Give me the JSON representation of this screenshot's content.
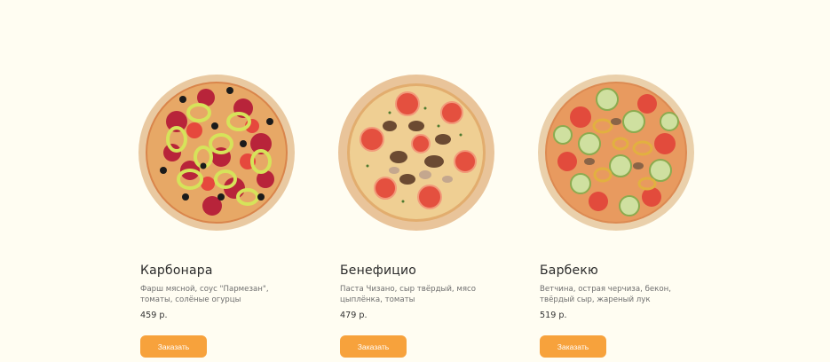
{
  "colors": {
    "background": "#fffdf2",
    "accent": "#f7a23c",
    "title": "#2b2b2b",
    "description": "#6f6f6f"
  },
  "products": [
    {
      "name": "Карбонара",
      "description": "Фарш мясной, соус \"Пармезан\", томаты, солёные огурцы",
      "price": "459 р.",
      "button": "Заказать",
      "image_icon": "pizza-carbonara-image"
    },
    {
      "name": "Бенефицио",
      "description": "Паста Чизано, сыр твёрдый, мясо цыплёнка, томаты",
      "price": "479 р.",
      "button": "Заказать",
      "image_icon": "pizza-beneficio-image"
    },
    {
      "name": "Барбекю",
      "description": "Ветчина, острая черчиза, бекон, твёрдый сыр, жареный лук",
      "price": "519 р.",
      "button": "Заказать",
      "image_icon": "pizza-barbecue-image"
    }
  ]
}
